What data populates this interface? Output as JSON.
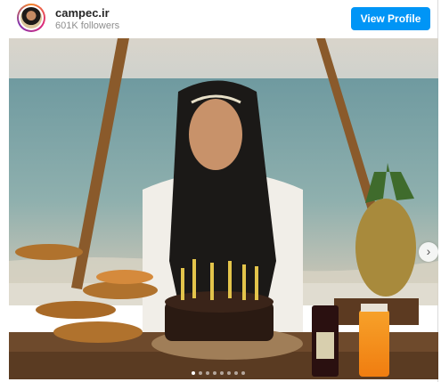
{
  "header": {
    "username": "campec.ir",
    "followers": "601K followers",
    "view_profile_label": "View Profile"
  },
  "post": {
    "image_alt": "Woman in headscarf seated behind birthday cake with candles by the sea",
    "carousel_next_icon": "chevron-right-icon",
    "carousel_dots": 8,
    "active_dot": 0
  },
  "colors": {
    "button": "#0095f6",
    "username": "#262626",
    "followers": "#8e8e8e"
  }
}
